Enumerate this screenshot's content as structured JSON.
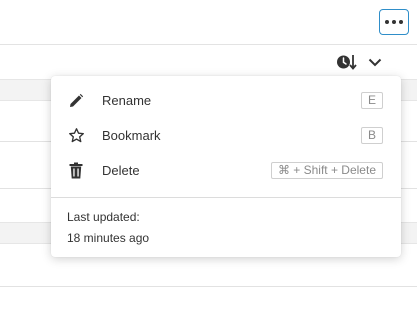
{
  "toolbar": {
    "more_icon": "more-horizontal-icon",
    "sort_icon": "clock-arrow-down-icon",
    "dropdown_icon": "chevron-down-icon",
    "accent_color": "#2f8ec9"
  },
  "menu": {
    "items": [
      {
        "label": "Rename",
        "shortcut": "E",
        "icon": "pencil-icon"
      },
      {
        "label": "Bookmark",
        "shortcut": "B",
        "icon": "star-outline-icon"
      },
      {
        "label": "Delete",
        "shortcut": "⌘ + Shift + Delete",
        "icon": "trash-icon"
      }
    ],
    "last_updated_label": "Last updated:",
    "last_updated_value": "18 minutes ago"
  }
}
